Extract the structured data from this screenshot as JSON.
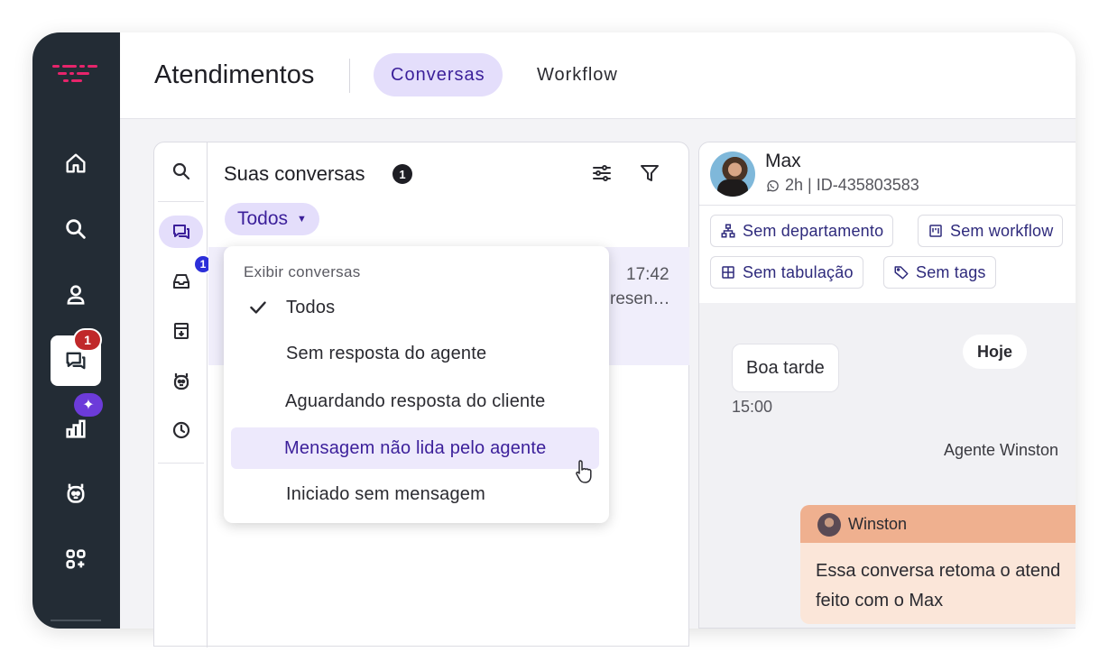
{
  "header": {
    "title": "Atendimentos",
    "tabs": [
      {
        "label": "Conversas",
        "active": true
      },
      {
        "label": "Workflow",
        "active": false
      }
    ]
  },
  "rail": {
    "items": [
      "home-icon",
      "search-icon",
      "user-icon",
      "chat-icon",
      "chart-icon",
      "bot-icon",
      "apps-icon"
    ],
    "active": "chat-icon",
    "chat_badge": "1",
    "chart_badge": "✦"
  },
  "conversations": {
    "title": "Suas conversas",
    "count": "1",
    "filter_chip": "Todos",
    "inbox_badge": "1",
    "preview": {
      "time": "17:42",
      "snippet": "resen…"
    }
  },
  "dropdown": {
    "header": "Exibir conversas",
    "options": [
      {
        "label": "Todos",
        "checked": true
      },
      {
        "label": "Sem resposta do agente",
        "checked": false
      },
      {
        "label": "Aguardando resposta do cliente",
        "checked": false
      },
      {
        "label": "Mensagem não lida pelo agente",
        "checked": false,
        "hover": true
      },
      {
        "label": "Iniciado sem mensagem",
        "checked": false
      }
    ]
  },
  "chat": {
    "contact_name": "Max",
    "contact_meta": "2h | ID-435803583",
    "tags": [
      "Sem departamento",
      "Sem workflow",
      "Sem tabulação",
      "Sem tags"
    ],
    "message": {
      "text": "Boa tarde",
      "time": "15:00"
    },
    "day_label": "Hoje",
    "agent_label": "Agente Winston",
    "note": {
      "author": "Winston",
      "line1": "Essa conversa retoma o atend",
      "line2": "feito com o Max"
    }
  },
  "colors": {
    "rail": "#232c35",
    "accent": "#3b1f9a",
    "accent_soft": "#e4defb",
    "badge_red": "#c0282a",
    "badge_blue": "#2c2fd9",
    "note_header": "#efb08f",
    "note_body": "#fbe6d9"
  }
}
